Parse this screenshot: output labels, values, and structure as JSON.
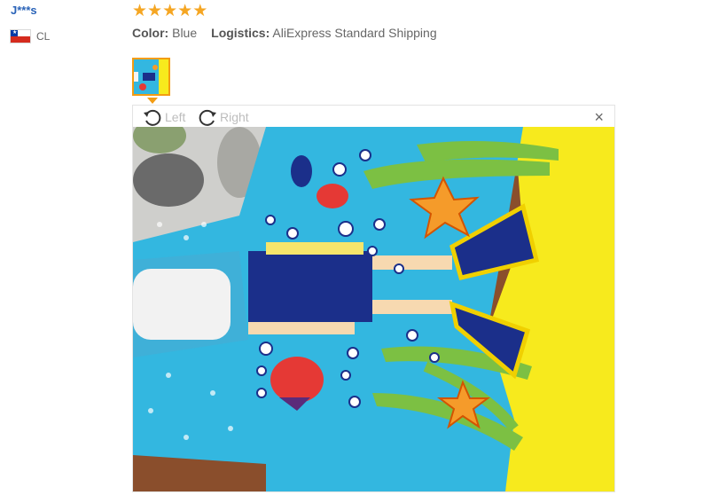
{
  "review": {
    "username": "J***s",
    "country_code": "CL",
    "rating": 5,
    "color_label": "Color:",
    "color_value": "Blue",
    "logistics_label": "Logistics:",
    "logistics_value": "AliExpress Standard Shipping"
  },
  "viewer": {
    "rotate_left_label": "Left",
    "rotate_right_label": "Right",
    "close_symbol": "×"
  },
  "icons": {
    "flag": "chile-flag-icon",
    "star": "star-icon",
    "rotate_left": "rotate-left-icon",
    "rotate_right": "rotate-right-icon",
    "close": "close-icon"
  },
  "colors": {
    "username": "#2a63b8",
    "star": "#f5a623",
    "thumb_border": "#f39c12",
    "towel_blue": "#33b7e0",
    "towel_yellow": "#f7ea1d"
  }
}
